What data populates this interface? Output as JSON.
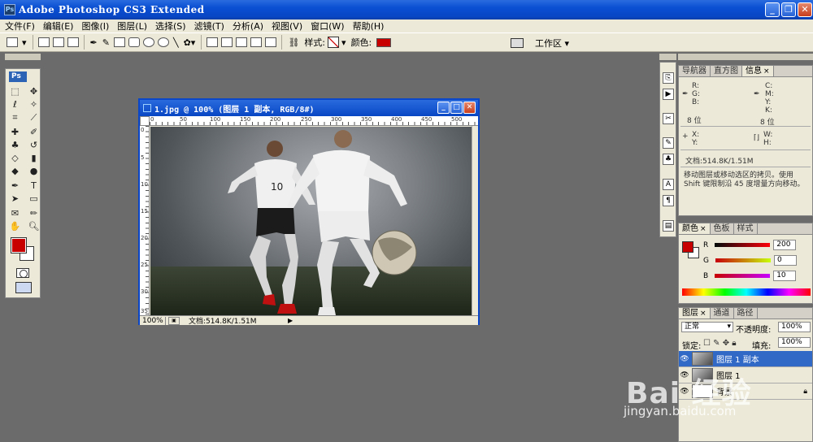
{
  "app": {
    "title": "Adobe Photoshop CS3 Extended",
    "logo": "Ps"
  },
  "menubar": [
    "文件(F)",
    "编辑(E)",
    "图像(I)",
    "图层(L)",
    "选择(S)",
    "滤镜(T)",
    "分析(A)",
    "视图(V)",
    "窗口(W)",
    "帮助(H)"
  ],
  "options_bar": {
    "style_label": "样式:",
    "color_label": "颜色:",
    "color_value": "#c80000",
    "workspace_label": "工作区 ▾"
  },
  "tools": {
    "badge": "Ps",
    "foreground_color": "#c80000",
    "background_color": "#ffffff"
  },
  "document": {
    "title": "1.jpg @ 100% (图层 1 副本, RGB/8#)",
    "zoom": "100%",
    "status": "文档:514.8K/1.51M",
    "ruler_h": [
      "0",
      "50",
      "100",
      "150",
      "200",
      "250",
      "300",
      "350",
      "400",
      "450",
      "500"
    ],
    "ruler_v": [
      "0",
      "5",
      "10",
      "15",
      "20",
      "25",
      "30",
      "35"
    ]
  },
  "navigator_panel": {
    "tabs": [
      "导航器",
      "直方图",
      "信息"
    ],
    "active_tab": "信息",
    "rgb_labels": [
      "R:",
      "G:",
      "B:"
    ],
    "cmyk_labels": [
      "C:",
      "M:",
      "Y:",
      "K:"
    ],
    "bit_left": "8 位",
    "bit_right": "8 位",
    "xy_labels": [
      "X:",
      "Y:"
    ],
    "wh_labels": [
      "W:",
      "H:"
    ],
    "doc_info": "文档:514.8K/1.51M",
    "hint": "移动图层或移动选区的拷贝。使用 Shift 键限制沿 45 度增量方向移动。"
  },
  "color_panel": {
    "tabs": [
      "颜色",
      "色板",
      "样式"
    ],
    "r_label": "R",
    "g_label": "G",
    "b_label": "B",
    "r": 200,
    "g": 0,
    "b": 10,
    "swatch": "#c80000"
  },
  "layers_panel": {
    "tabs": [
      "图层",
      "通道",
      "路径"
    ],
    "blend_mode": "正常",
    "opacity_label": "不透明度:",
    "opacity": "100%",
    "lock_label": "锁定:",
    "fill_label": "填充:",
    "fill": "100%",
    "layers": [
      {
        "name": "图层 1 副本",
        "active": true
      },
      {
        "name": "图层 1",
        "active": false
      },
      {
        "name": "背景",
        "active": false
      }
    ]
  },
  "watermark": {
    "logo": "Bai 经验",
    "url": "jingyan.baidu.com"
  }
}
